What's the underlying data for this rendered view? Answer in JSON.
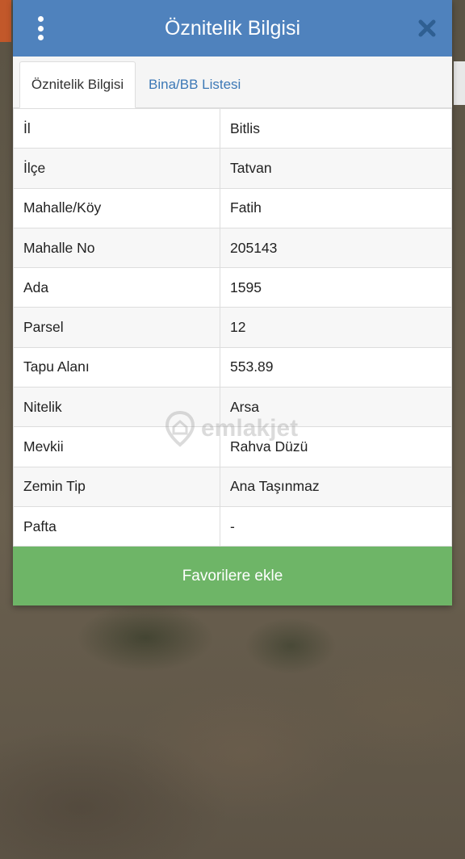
{
  "header": {
    "title": "Öznitelik Bilgisi",
    "menu_icon": "more-vertical-icon",
    "close_icon": "close-icon"
  },
  "tabs": [
    {
      "label": "Öznitelik Bilgisi",
      "active": true
    },
    {
      "label": "Bina/BB Listesi",
      "active": false
    }
  ],
  "attributes": [
    {
      "label": "İl",
      "value": "Bitlis"
    },
    {
      "label": "İlçe",
      "value": "Tatvan"
    },
    {
      "label": "Mahalle/Köy",
      "value": "Fatih"
    },
    {
      "label": "Mahalle No",
      "value": "205143"
    },
    {
      "label": "Ada",
      "value": "1595"
    },
    {
      "label": "Parsel",
      "value": "12"
    },
    {
      "label": "Tapu Alanı",
      "value": "553.89"
    },
    {
      "label": "Nitelik",
      "value": "Arsa"
    },
    {
      "label": "Mevkii",
      "value": "Rahva Düzü"
    },
    {
      "label": "Zemin Tip",
      "value": "Ana Taşınmaz"
    },
    {
      "label": "Pafta",
      "value": "-"
    }
  ],
  "actions": {
    "favorite_label": "Favorilere ekle"
  },
  "watermark": {
    "text": "emlakjet",
    "icon": "map-pin-home-icon"
  },
  "colors": {
    "header": "#4f82bd",
    "tab_link": "#3c78b6",
    "favorite_button": "#6eb567"
  }
}
